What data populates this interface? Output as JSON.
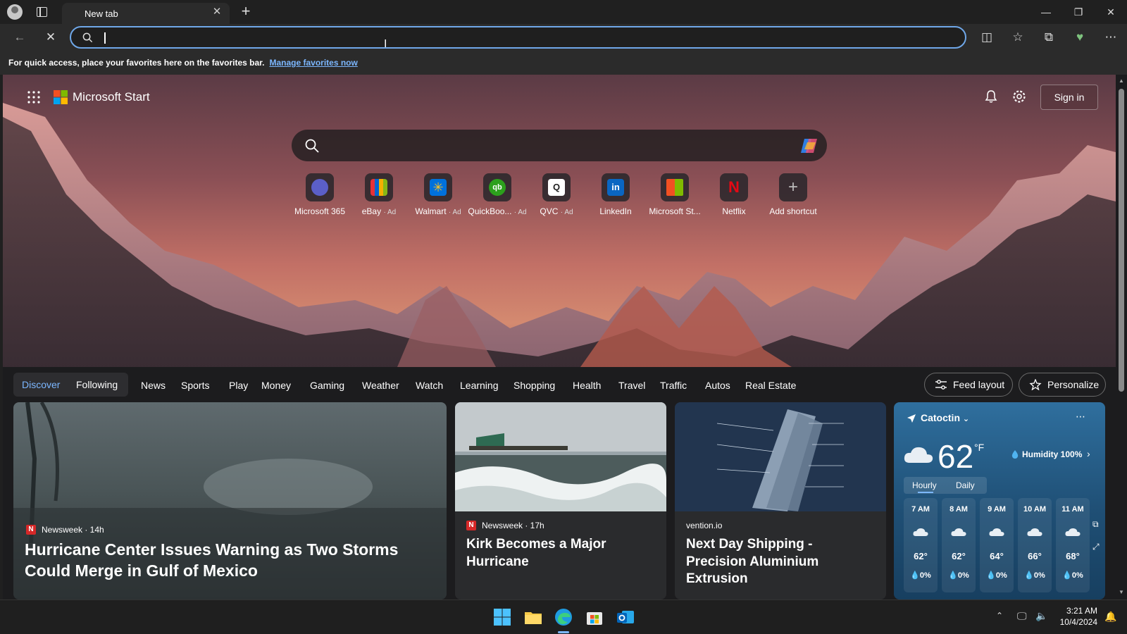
{
  "browser": {
    "tab_title": "New tab",
    "favorites_text": "For quick access, place your favorites here on the favorites bar.",
    "favorites_link": "Manage favorites now"
  },
  "header": {
    "brand": "Microsoft Start",
    "sign_in": "Sign in"
  },
  "shortcuts": [
    {
      "label": "Microsoft 365",
      "ad": "",
      "color": "#5b5fc7"
    },
    {
      "label": "eBay",
      "ad": "· Ad",
      "color": "#f5af02"
    },
    {
      "label": "Walmart",
      "ad": "· Ad",
      "color": "#0071dc"
    },
    {
      "label": "QuickBoo...",
      "ad": "· Ad",
      "color": "#2ca01c"
    },
    {
      "label": "QVC",
      "ad": "· Ad",
      "color": "#ffffff"
    },
    {
      "label": "LinkedIn",
      "ad": "",
      "color": "#0a66c2"
    },
    {
      "label": "Microsoft St...",
      "ad": "",
      "color": "#f25022"
    },
    {
      "label": "Netflix",
      "ad": "",
      "color": "#e50914"
    },
    {
      "label": "Add shortcut",
      "ad": "",
      "color": "#3a3a3a"
    }
  ],
  "categories": {
    "discover": "Discover",
    "following": "Following",
    "items": [
      "News",
      "Sports",
      "Play",
      "Money",
      "Gaming",
      "Weather",
      "Watch",
      "Learning",
      "Shopping",
      "Health",
      "Travel",
      "Traffic",
      "Autos",
      "Real Estate"
    ],
    "feed_layout": "Feed layout",
    "personalize": "Personalize"
  },
  "cards": [
    {
      "source": "Newsweek · 14h",
      "logo": "N",
      "title": "Hurricane Center Issues Warning as Two Storms Could Merge in Gulf of Mexico"
    },
    {
      "source": "Newsweek · 17h",
      "logo": "N",
      "title": "Kirk Becomes a Major Hurricane"
    },
    {
      "source": "vention.io",
      "logo": "",
      "title": "Next Day Shipping - Precision Aluminium Extrusion"
    }
  ],
  "weather": {
    "location": "Catoctin",
    "temp": "62",
    "unit": "°F",
    "humidity": "Humidity 100%",
    "tab_hourly": "Hourly",
    "tab_daily": "Daily",
    "hours": [
      {
        "time": "7 AM",
        "temp": "62°",
        "precip": "0%"
      },
      {
        "time": "8 AM",
        "temp": "62°",
        "precip": "0%"
      },
      {
        "time": "9 AM",
        "temp": "64°",
        "precip": "0%"
      },
      {
        "time": "10 AM",
        "temp": "66°",
        "precip": "0%"
      },
      {
        "time": "11 AM",
        "temp": "68°",
        "precip": "0%"
      }
    ]
  },
  "taskbar": {
    "time": "3:21 AM",
    "date": "10/4/2024"
  }
}
